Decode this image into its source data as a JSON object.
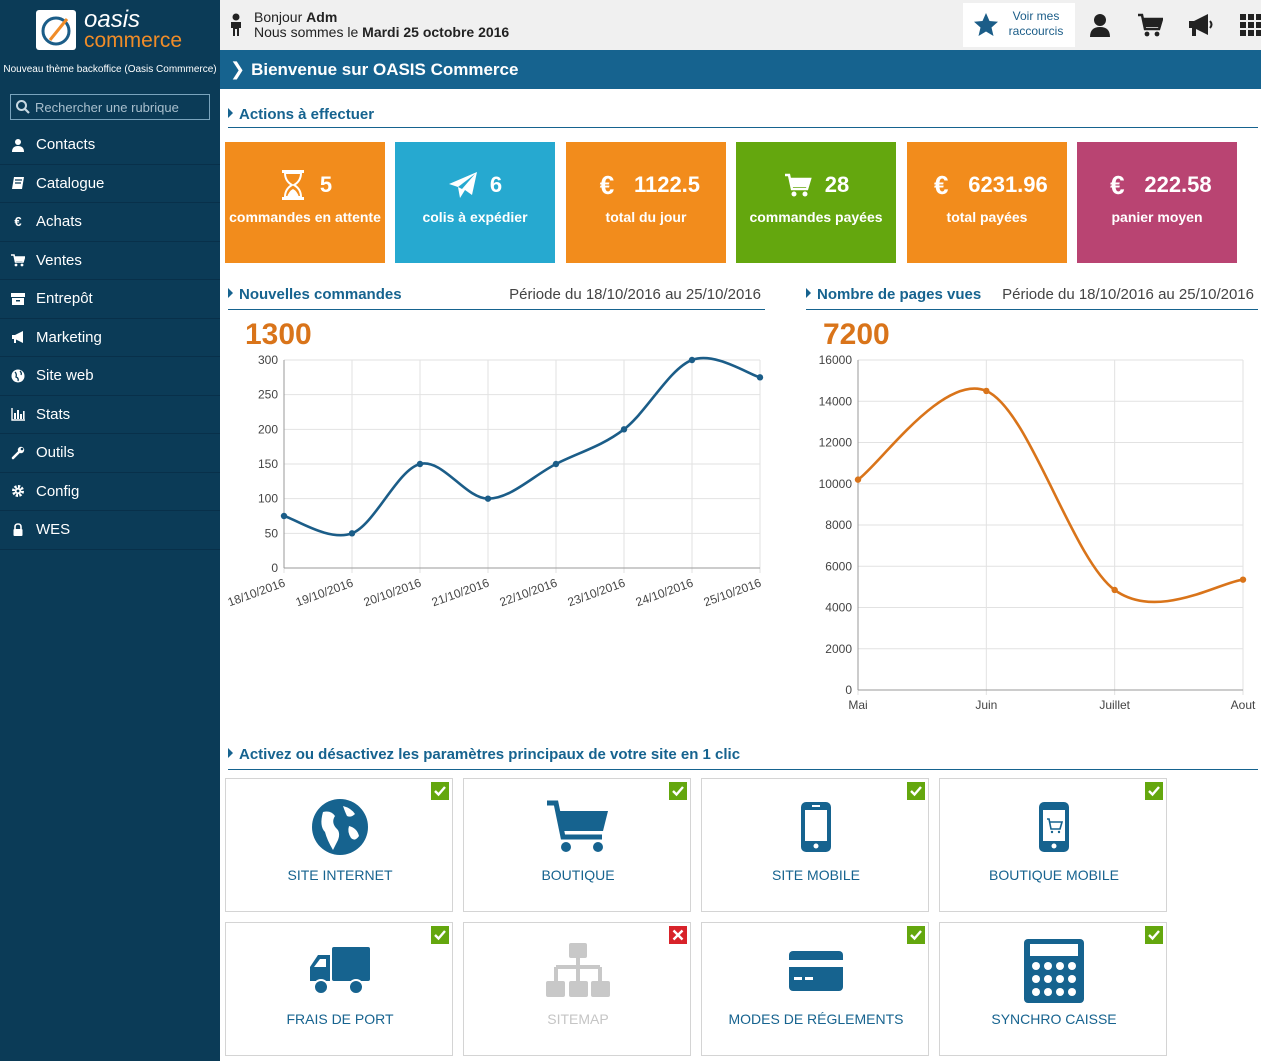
{
  "brand": {
    "line1": "oasis",
    "line2": "commerce",
    "theme_note": "Nouveau thème backoffice (Oasis Commmerce)"
  },
  "search": {
    "placeholder": "Rechercher une rubrique"
  },
  "nav": [
    {
      "label": "Contacts",
      "icon": "user-icon"
    },
    {
      "label": "Catalogue",
      "icon": "book-icon"
    },
    {
      "label": "Achats",
      "icon": "euro-icon"
    },
    {
      "label": "Ventes",
      "icon": "cart-icon"
    },
    {
      "label": "Entrepôt",
      "icon": "archive-icon"
    },
    {
      "label": "Marketing",
      "icon": "megaphone-icon"
    },
    {
      "label": "Site web",
      "icon": "globe-icon"
    },
    {
      "label": "Stats",
      "icon": "bar-chart-icon"
    },
    {
      "label": "Outils",
      "icon": "wrench-icon"
    },
    {
      "label": "Config",
      "icon": "gear-icon"
    },
    {
      "label": "WES",
      "icon": "lock-icon"
    }
  ],
  "header": {
    "greet_prefix": "Bonjour ",
    "user": "Adm",
    "date_prefix": "Nous sommes le ",
    "date": "Mardi 25 octobre 2016",
    "shortcut_line1": "Voir mes",
    "shortcut_line2": "raccourcis"
  },
  "banner": {
    "title": "Bienvenue sur OASIS Commerce"
  },
  "actions": {
    "title": "Actions à effectuer",
    "tiles": [
      {
        "value": "5",
        "label": "commandes en attente",
        "icon": "hourglass-icon",
        "color": "#f28c1c"
      },
      {
        "value": "6",
        "label": "colis à expédier",
        "icon": "paper-plane-icon",
        "color": "#26a9d0"
      },
      {
        "value": "1122.5",
        "label": "total du jour",
        "icon": "euro-icon",
        "color": "#f28c1c"
      },
      {
        "value": "28",
        "label": "commandes payées",
        "icon": "cart-icon",
        "color": "#64a70e"
      },
      {
        "value": "6231.96",
        "label": "total payées",
        "icon": "euro-icon",
        "color": "#f28c1c"
      },
      {
        "value": "222.58",
        "label": "panier moyen",
        "icon": "euro-icon",
        "color": "#b94472"
      }
    ]
  },
  "orders_chart": {
    "title": "Nouvelles commandes",
    "period": "Période du 18/10/2016 au 25/10/2016",
    "total": "1300"
  },
  "views_chart": {
    "title": "Nombre de pages vues",
    "period": "Période du 18/10/2016 au 25/10/2016",
    "total": "7200"
  },
  "chart_data": [
    {
      "type": "line",
      "color": "#1b5d88",
      "categories": [
        "18/10/2016",
        "19/10/2016",
        "20/10/2016",
        "21/10/2016",
        "22/10/2016",
        "23/10/2016",
        "24/10/2016",
        "25/10/2016"
      ],
      "values": [
        75,
        50,
        150,
        100,
        150,
        200,
        300,
        275
      ],
      "yticks": [
        0,
        50,
        100,
        150,
        200,
        250,
        300
      ],
      "ylim": [
        0,
        300
      ],
      "grid": true
    },
    {
      "type": "line",
      "color": "#d9741a",
      "categories": [
        "Mai",
        "Juin",
        "Juillet",
        "Aout"
      ],
      "values": [
        10200,
        14500,
        4850,
        5350
      ],
      "yticks": [
        0,
        2000,
        4000,
        6000,
        8000,
        10000,
        12000,
        14000,
        16000
      ],
      "ylim": [
        0,
        16000
      ],
      "grid": true
    }
  ],
  "toggles": {
    "title": "Activez ou désactivez les paramètres principaux de votre site en 1 clic",
    "items": [
      {
        "label": "SITE INTERNET",
        "icon": "globe-icon",
        "enabled": true
      },
      {
        "label": "BOUTIQUE",
        "icon": "cart-icon",
        "enabled": true
      },
      {
        "label": "SITE MOBILE",
        "icon": "mobile-icon",
        "enabled": true
      },
      {
        "label": "BOUTIQUE MOBILE",
        "icon": "mobile-cart-icon",
        "enabled": true
      },
      {
        "label": "FRAIS DE PORT",
        "icon": "truck-icon",
        "enabled": true
      },
      {
        "label": "SITEMAP",
        "icon": "sitemap-icon",
        "enabled": false
      },
      {
        "label": "MODES DE RÉGLEMENTS",
        "icon": "credit-card-icon",
        "enabled": true
      },
      {
        "label": "SYNCHRO CAISSE",
        "icon": "calculator-icon",
        "enabled": true
      }
    ]
  },
  "colors": {
    "sidebar": "#0b3b57",
    "banner": "#16638f",
    "accent": "#d9741a",
    "check_on": "#64a70e",
    "check_off": "#d8232a"
  }
}
